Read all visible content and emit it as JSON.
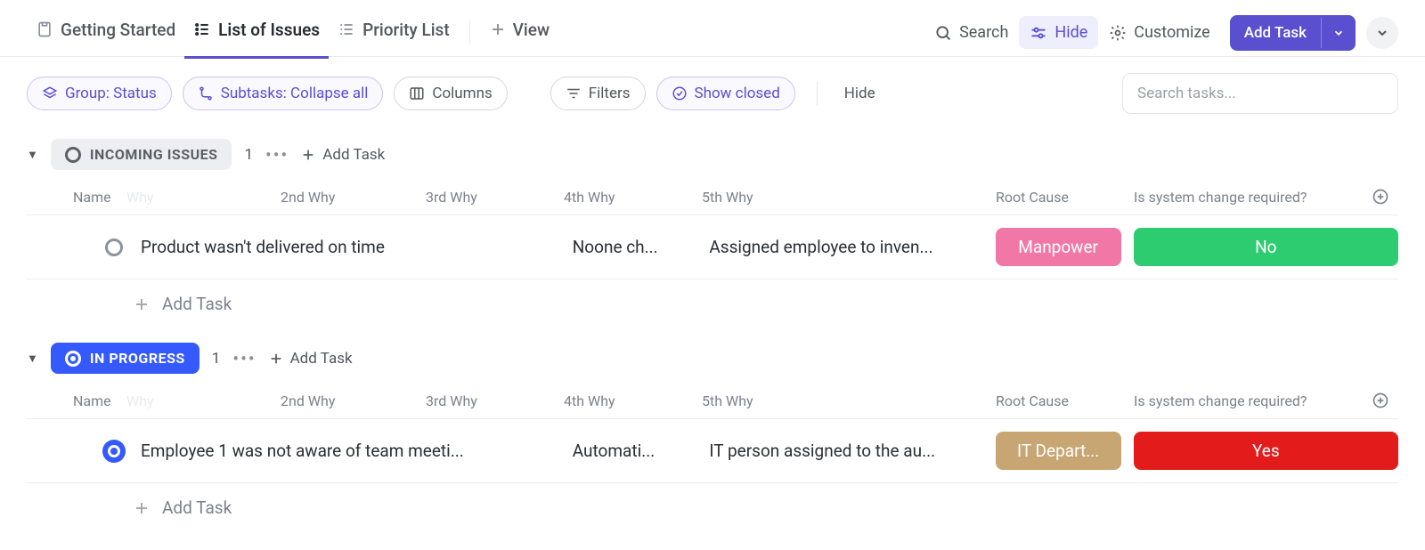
{
  "tabs": {
    "getting_started": "Getting Started",
    "list_of_issues": "List of Issues",
    "priority_list": "Priority List",
    "view": "View"
  },
  "topactions": {
    "search": "Search",
    "hide": "Hide",
    "customize": "Customize",
    "add_task": "Add Task"
  },
  "filters": {
    "group": "Group: Status",
    "subtasks": "Subtasks: Collapse all",
    "columns": "Columns",
    "filters": "Filters",
    "show_closed": "Show closed",
    "hide": "Hide",
    "search_placeholder": "Search tasks..."
  },
  "columns": {
    "name": "Name",
    "name_ghost": "Why",
    "w2": "2nd Why",
    "w3": "3rd Why",
    "w4": "4th Why",
    "w5": "5th Why",
    "root": "Root Cause",
    "sys": "Is system change required?"
  },
  "groups": [
    {
      "status": "INCOMING ISSUES",
      "style": "grey",
      "count": "1",
      "add": "Add Task",
      "tasks": [
        {
          "name": "Product wasn't delivered on time",
          "w4": "Noone ch...",
          "w5": "Assigned employee to inven...",
          "root": "Manpower",
          "root_color": "pink",
          "sys": "No",
          "sys_color": "green"
        }
      ],
      "addrow": "Add Task"
    },
    {
      "status": "IN PROGRESS",
      "style": "blue",
      "count": "1",
      "add": "Add Task",
      "tasks": [
        {
          "name": "Employee 1 was not aware of team meeti...",
          "w4": "Automati...",
          "w5": "IT person assigned to the au...",
          "root": "IT Depart...",
          "root_color": "tan",
          "sys": "Yes",
          "sys_color": "red"
        }
      ],
      "addrow": "Add Task"
    }
  ]
}
